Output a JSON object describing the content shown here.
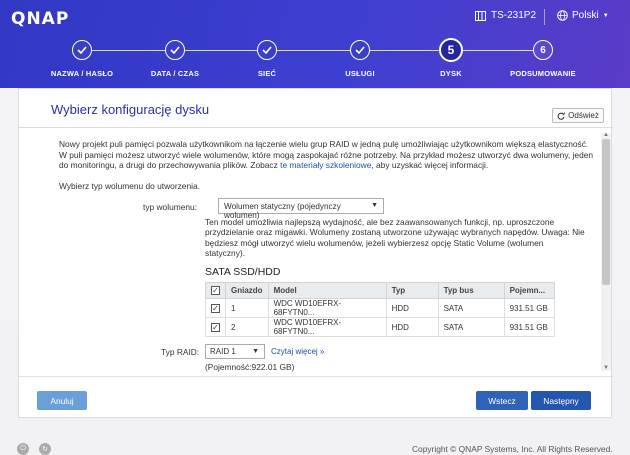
{
  "header": {
    "logo": "QNAP",
    "device_name": "TS-231P2",
    "language": "Polski"
  },
  "steps": [
    {
      "label": "NAZWA / HASŁO",
      "status": "done"
    },
    {
      "label": "DATA / CZAS",
      "status": "done"
    },
    {
      "label": "SIEĆ",
      "status": "done"
    },
    {
      "label": "USŁUGI",
      "status": "done"
    },
    {
      "label": "DYSK",
      "number": "5",
      "status": "current"
    },
    {
      "label": "PODSUMOWANIE",
      "number": "6",
      "status": "todo"
    }
  ],
  "panel": {
    "title": "Wybierz konfigurację dysku",
    "refresh_label": "Odśwież",
    "intro_text": "Nowy projekt puli pamięci pozwala użytkownikom na łączenie wielu grup RAID w jedną pulę umożliwiając użytkownikom większą elastyczność. W puli pamięci możesz utworzyć wiele wolumenów, które mogą zaspokajać różne potrzeby. Na przykład możesz utworzyć dwa wolumeny, jeden do monitoringu, a drugi do przechowywania plików. Zobacz ",
    "intro_link": "te materiały szkoleniowe",
    "intro_tail": ", aby uzyskać więcej informacji.",
    "choose_type": "Wybierz typ wolumenu do utworzenia.",
    "volume_type_label": "typ wolumenu:",
    "volume_type_value": "Wolumen statyczny (pojedynczy wolumen)",
    "volume_desc": "Ten model umożliwia najlepszą wydajność, ale bez zaawansowanych funkcji, np. uproszczone przydzielanie oraz migawki. Wolumeny zostaną utworzone używając wybranych napędów. Uwaga: Nie będziesz mógł utworzyć wielu wolumenów, jeżeli wybierzesz opcję Static Volume (wolumen statyczny).",
    "sata_title": "SATA SSD/HDD",
    "table": {
      "headers": [
        "",
        "Gniazdo",
        "Model",
        "Typ",
        "Typ bus",
        "Pojemn..."
      ],
      "rows": [
        {
          "slot": "1",
          "model": "WDC WD10EFRX-68FYTN0...",
          "type": "HDD",
          "bus": "SATA",
          "capacity": "931.51 GB"
        },
        {
          "slot": "2",
          "model": "WDC WD10EFRX-68FYTN0...",
          "type": "HDD",
          "bus": "SATA",
          "capacity": "931.51 GB"
        }
      ]
    },
    "raid_label": "Typ RAID:",
    "raid_value": "RAID 1",
    "more_link": "Czytaj więcej »",
    "capacity": "(Pojemność:922.01 GB)",
    "cancel_label": "Anuluj",
    "back_label": "Wstecz",
    "next_label": "Następny"
  },
  "footer": {
    "copyright": "Copyright © QNAP Systems, Inc. All Rights Reserved."
  }
}
